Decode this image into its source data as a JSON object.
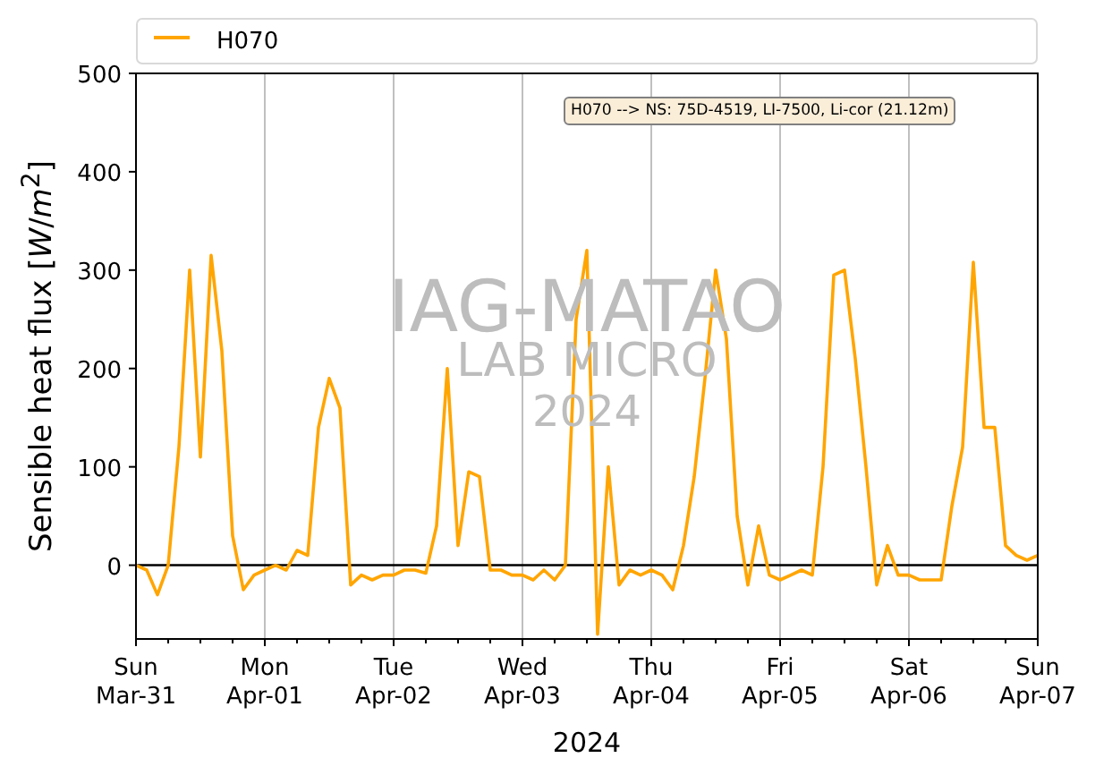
{
  "chart": {
    "annotation": "H070 --> NS: 75D-4519, LI-7500, Li-cor (21.12m)",
    "watermark": [
      "IAG-MATAO",
      "LAB MICRO",
      "2024"
    ],
    "chart_data": {
      "type": "line",
      "xlabel": "2024",
      "ylabel": "Sensible heat flux [*W*/*m*$^{2}$]",
      "categories": [
        "Sun\nMar-31",
        null,
        null,
        null,
        null,
        null,
        null,
        null,
        null,
        null,
        null,
        null,
        "Mon\nApr-01",
        null,
        null,
        null,
        null,
        null,
        null,
        null,
        null,
        null,
        null,
        null,
        "Tue\nApr-02",
        null,
        null,
        null,
        null,
        null,
        null,
        null,
        null,
        null,
        null,
        null,
        "Wed\nApr-03",
        null,
        null,
        null,
        null,
        null,
        null,
        null,
        null,
        null,
        null,
        null,
        "Thu\nApr-04",
        null,
        null,
        null,
        null,
        null,
        null,
        null,
        null,
        null,
        null,
        null,
        "Fri\nApr-05",
        null,
        null,
        null,
        null,
        null,
        null,
        null,
        null,
        null,
        null,
        null,
        "Sat\nApr-06",
        null,
        null,
        null,
        null,
        null,
        null,
        null,
        null,
        null,
        null,
        null,
        "Sun\nApr-07"
      ],
      "series": [
        {
          "name": "H070",
          "color": "#ffa500",
          "values": [
            0,
            -5,
            -30,
            0,
            120,
            300,
            110,
            315,
            218,
            30,
            -25,
            -10,
            -5,
            0,
            -5,
            15,
            10,
            140,
            190,
            160,
            -20,
            -10,
            -15,
            -10,
            -10,
            -5,
            -5,
            -8,
            40,
            200,
            20,
            95,
            90,
            -5,
            -5,
            -10,
            -10,
            -15,
            -5,
            -15,
            0,
            250,
            320,
            -70,
            100,
            -20,
            -5,
            -10,
            -5,
            -10,
            -25,
            20,
            90,
            190,
            300,
            230,
            50,
            -20,
            40,
            -10,
            -15,
            -10,
            -5,
            -10,
            100,
            295,
            300,
            210,
            100,
            -20,
            20,
            -10,
            -10,
            -15,
            -15,
            -15,
            60,
            120,
            308,
            140,
            140,
            20,
            10,
            5,
            10
          ]
        }
      ],
      "grid": "x",
      "ylim": [
        -75,
        500
      ],
      "yticks": [
        0,
        100,
        200,
        300,
        400,
        500
      ]
    }
  }
}
